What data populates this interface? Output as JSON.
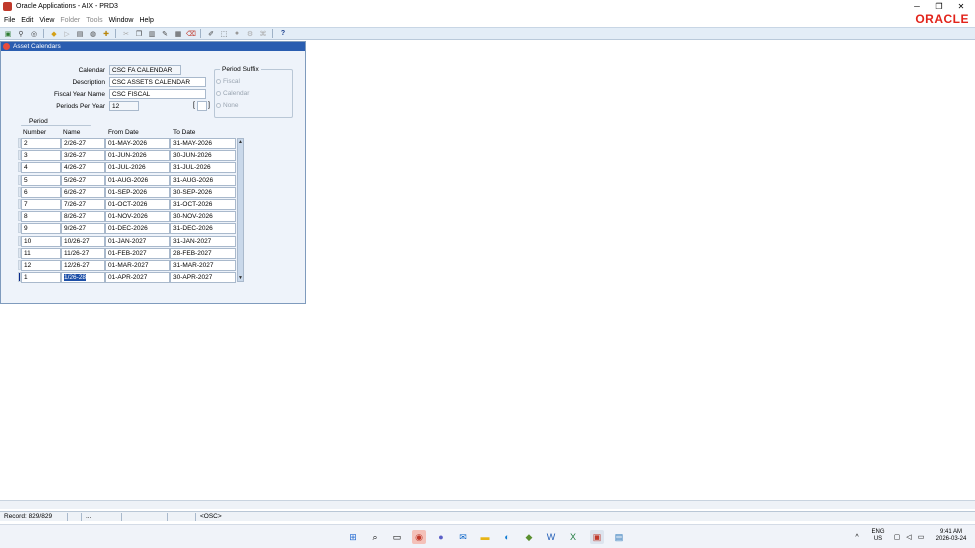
{
  "window": {
    "title": "Oracle Applications - AIX - PRD3",
    "minimize": "─",
    "restore": "❐",
    "close": "✕"
  },
  "brand": {
    "logo_text": "ORACLE",
    "color": "#e2231a"
  },
  "menu": [
    {
      "label": "File",
      "enabled": true
    },
    {
      "label": "Edit",
      "enabled": true
    },
    {
      "label": "View",
      "enabled": true
    },
    {
      "label": "Folder",
      "enabled": false
    },
    {
      "label": "Tools",
      "enabled": false
    },
    {
      "label": "Window",
      "enabled": true
    },
    {
      "label": "Help",
      "enabled": true
    }
  ],
  "toolbar_icons": [
    "new-icon",
    "find-icon",
    "show-navigator-icon",
    "save-icon",
    "next-step-icon",
    "print-icon",
    "close-form-icon",
    "new-record-icon",
    "delete-record-icon",
    "cut-icon",
    "copy-icon",
    "paste-icon",
    "clear-icon",
    "folder-icon",
    "attachments-icon",
    "zoom-icon",
    "translations-icon",
    "help-icon"
  ],
  "form": {
    "title": "Asset Calendars",
    "labels": {
      "calendar": "Calendar",
      "description": "Description",
      "fiscal_year_name": "Fiscal Year Name",
      "periods_per_year": "Periods Per Year"
    },
    "values": {
      "calendar": "CSC FA CALENDAR",
      "description": "CSC ASSETS CALENDAR",
      "fiscal_year_name": "CSC FISCAL",
      "periods_per_year": "12",
      "bracket_left": "[",
      "bracket_right": "]"
    },
    "period_suffix": {
      "title": "Period Suffix",
      "options": [
        "Fiscal",
        "Calendar",
        "None"
      ]
    },
    "period_group": {
      "title": "Period",
      "headers": {
        "number": "Number",
        "name": "Name",
        "from_date": "From Date",
        "to_date": "To Date"
      }
    },
    "rows": [
      {
        "number": "2",
        "name": "2/26-27",
        "from": "01-MAY-2026",
        "to": "31-MAY-2026"
      },
      {
        "number": "3",
        "name": "3/26-27",
        "from": "01-JUN-2026",
        "to": "30-JUN-2026"
      },
      {
        "number": "4",
        "name": "4/26-27",
        "from": "01-JUL-2026",
        "to": "31-JUL-2026"
      },
      {
        "number": "5",
        "name": "5/26-27",
        "from": "01-AUG-2026",
        "to": "31-AUG-2026"
      },
      {
        "number": "6",
        "name": "6/26-27",
        "from": "01-SEP-2026",
        "to": "30-SEP-2026"
      },
      {
        "number": "7",
        "name": "7/26-27",
        "from": "01-OCT-2026",
        "to": "31-OCT-2026"
      },
      {
        "number": "8",
        "name": "8/26-27",
        "from": "01-NOV-2026",
        "to": "30-NOV-2026"
      },
      {
        "number": "9",
        "name": "9/26-27",
        "from": "01-DEC-2026",
        "to": "31-DEC-2026"
      },
      {
        "number": "10",
        "name": "10/26-27",
        "from": "01-JAN-2027",
        "to": "31-JAN-2027"
      },
      {
        "number": "11",
        "name": "11/26-27",
        "from": "01-FEB-2027",
        "to": "28-FEB-2027"
      },
      {
        "number": "12",
        "name": "12/26-27",
        "from": "01-MAR-2027",
        "to": "31-MAR-2027"
      },
      {
        "number": "1",
        "name": "1/26-28",
        "from": "01-APR-2027",
        "to": "30-APR-2027"
      }
    ]
  },
  "status": {
    "record": "Record: 829/829",
    "seg2": "",
    "seg3": "...",
    "seg4": "",
    "seg5": "",
    "osc": "<OSC>"
  },
  "taskbar": {
    "apps": [
      "start-icon",
      "search-icon",
      "task-view-icon",
      "chrome-icon",
      "teams-icon",
      "outlook-icon",
      "file-explorer-icon",
      "edge-icon",
      "android-icon",
      "word-icon",
      "excel-icon",
      "oracle-forms-icon",
      "notepad-icon"
    ],
    "chevron": "^",
    "lang": "ENG",
    "region": "US",
    "time": "9:41 AM",
    "date": "2026-03-24"
  }
}
